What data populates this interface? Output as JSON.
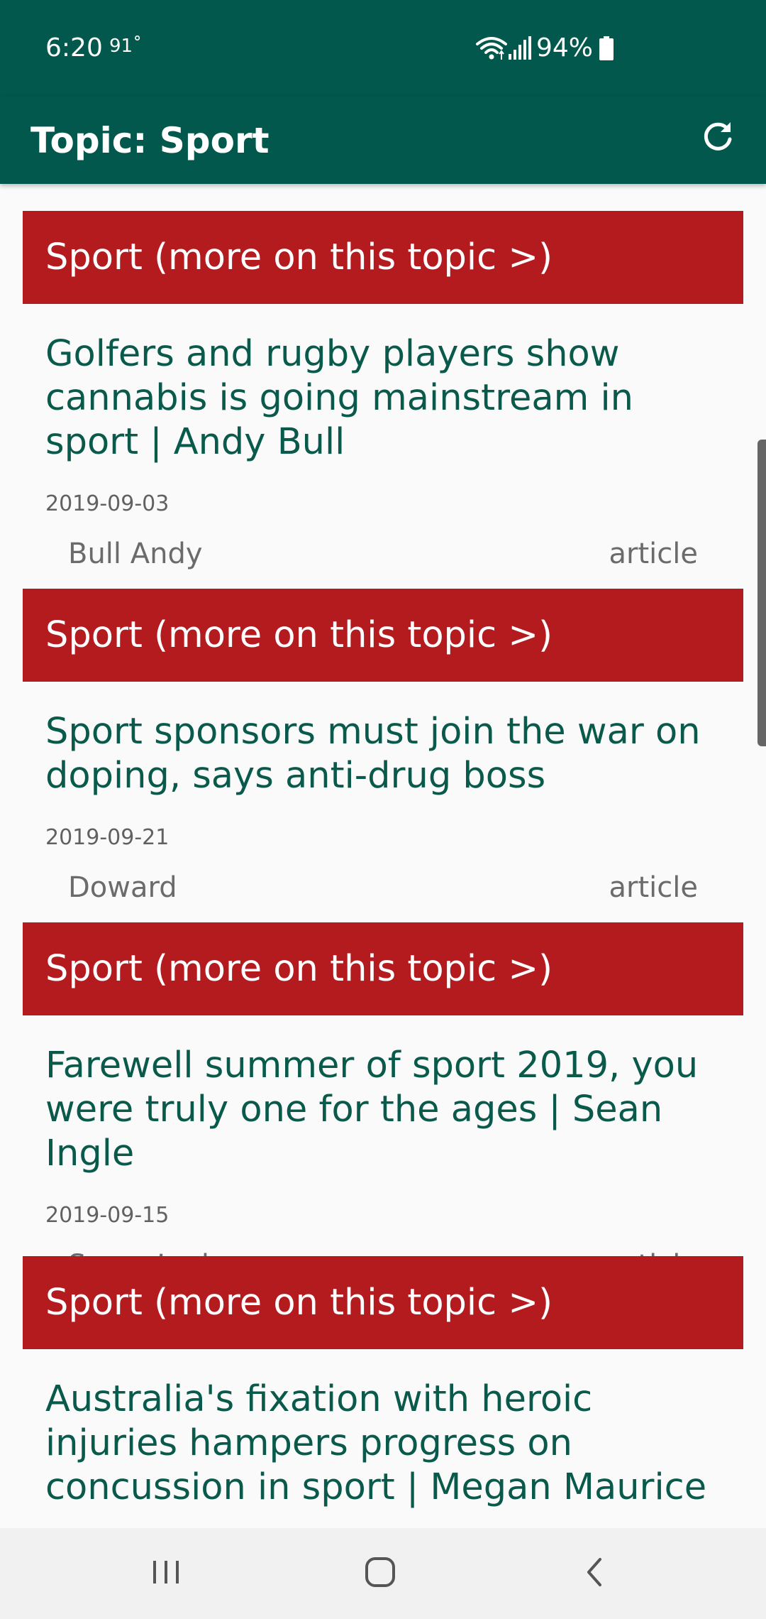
{
  "status_bar": {
    "time": "6:20",
    "temperature": "91˚",
    "battery": "94%",
    "icons": [
      "wifi-icon",
      "signal-icon",
      "battery-icon"
    ]
  },
  "app_bar": {
    "title": "Topic: Sport",
    "action_icon": "refresh-icon"
  },
  "articles": [
    {
      "topic_label": "Sport (more on this topic >)",
      "headline": "Golfers and rugby players show cannabis is going mainstream in sport  |  Andy Bull",
      "date": "2019-09-03",
      "author": "Bull Andy",
      "type": "article"
    },
    {
      "topic_label": "Sport (more on this topic >)",
      "headline": "Sport sponsors must join the war on doping, says anti-drug boss",
      "date": "2019-09-21",
      "author": "Doward",
      "type": "article"
    },
    {
      "topic_label": "Sport (more on this topic >)",
      "headline": "Farewell summer of sport 2019, you were truly one for the ages | Sean Ingle",
      "date": "2019-09-15",
      "author": "Sean  Ingle",
      "type": "article"
    },
    {
      "topic_label": "Sport (more on this topic >)",
      "headline": "Australia's fixation with heroic injuries hampers progress on concussion in sport | Megan Maurice",
      "date": "",
      "author": "",
      "type": ""
    }
  ],
  "nav_bar": {
    "icons": [
      "recent-apps-icon",
      "home-icon",
      "back-icon"
    ]
  },
  "colors": {
    "primary": "#02584c",
    "topic_banner": "#b31b1e",
    "headline": "#0a5a4c"
  }
}
